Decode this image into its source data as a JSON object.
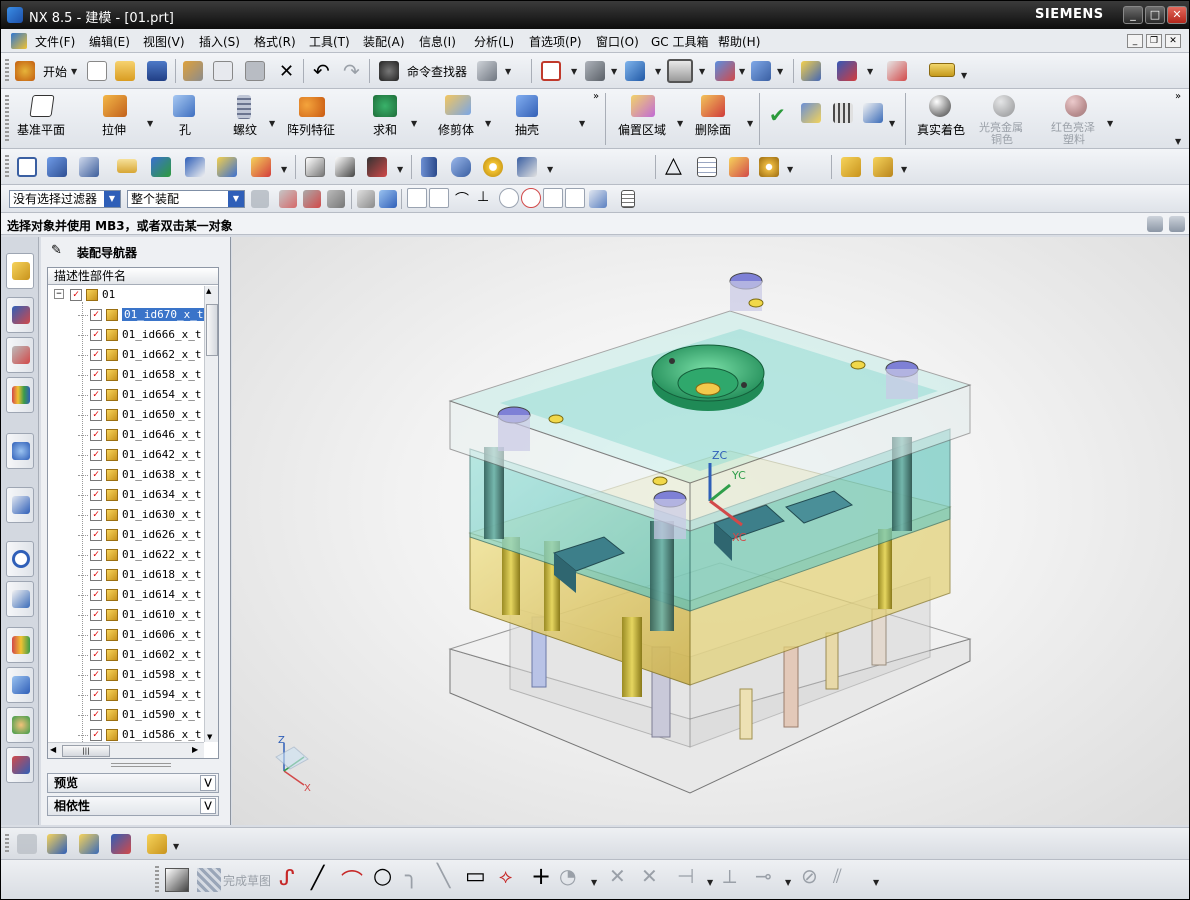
{
  "title_bar": {
    "title": "NX 8.5 - 建模 - [01.prt]",
    "brand": "SIEMENS",
    "min": "_",
    "max": "□",
    "close": "✕"
  },
  "menu": [
    "文件(F)",
    "编辑(E)",
    "视图(V)",
    "插入(S)",
    "格式(R)",
    "工具(T)",
    "装配(A)",
    "信息(I)",
    "分析(L)",
    "首选项(P)",
    "窗口(O)",
    "GC 工具箱",
    "帮助(H)"
  ],
  "std_toolbar": {
    "start_label": "开始",
    "find_command_label": "命令查找器"
  },
  "feature_toolbar": {
    "datum_plane": "基准平面",
    "extrude": "拉伸",
    "hole": "孔",
    "thread": "螺纹",
    "pattern_feature": "阵列特征",
    "unite": "求和",
    "trim_body": "修剪体",
    "shell": "抽壳",
    "offset_region": "偏置区域",
    "delete_face": "删除面",
    "true_shading": "真实着色",
    "shiny_metal_line1": "光亮金属",
    "shiny_metal_line2": "铜色",
    "red_paint_line1": "红色亮泽",
    "red_paint_line2": "塑料"
  },
  "selection_bar": {
    "filter_value": "没有选择过滤器",
    "scope_value": "整个装配"
  },
  "cue_line": "选择对象并使用 MB3，或者双击某一对象",
  "navigator": {
    "title": "装配导航器",
    "column_header": "描述性部件名",
    "root": "01",
    "items": [
      "01_id670_x_t",
      "01_id666_x_t",
      "01_id662_x_t",
      "01_id658_x_t",
      "01_id654_x_t",
      "01_id650_x_t",
      "01_id646_x_t",
      "01_id642_x_t",
      "01_id638_x_t",
      "01_id634_x_t",
      "01_id630_x_t",
      "01_id626_x_t",
      "01_id622_x_t",
      "01_id618_x_t",
      "01_id614_x_t",
      "01_id610_x_t",
      "01_id606_x_t",
      "01_id602_x_t",
      "01_id598_x_t",
      "01_id594_x_t",
      "01_id590_x_t",
      "01_id586_x_t"
    ],
    "selected_index": 0,
    "preview_label": "预览",
    "dependencies_label": "相依性"
  },
  "viewport": {
    "wcs_z": "ZC",
    "wcs_y": "YC",
    "wcs_x": "XC",
    "triad_z": "Z",
    "triad_x": "X"
  },
  "sketch_toolbar": {
    "finish_sketch": "完成草图"
  },
  "colors": {
    "accent": "#3a74c9",
    "title_bg": "#1a1a1a",
    "mold_plate_cyan": "#7fd3cf",
    "mold_plate_yellow": "#e7d77a",
    "sprue_green": "#3fb585"
  }
}
